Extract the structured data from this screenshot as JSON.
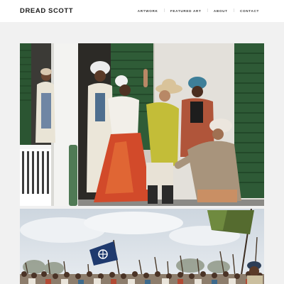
{
  "site": {
    "brand": "DREAD SCOTT"
  },
  "nav": {
    "items": [
      {
        "label": "ARTWORK"
      },
      {
        "label": "FEATURED ART"
      },
      {
        "label": "ABOUT"
      },
      {
        "label": "CONTACT"
      }
    ],
    "separator": "|"
  },
  "gallery": {
    "photos": [
      {
        "subject": "performers in historical costume on a plantation house porch"
      },
      {
        "subject": "crowd of marchers raising tools and flags under a cloudy sky"
      }
    ]
  },
  "colors": {
    "header_bg": "#ffffff",
    "page_bg": "#f1f1f1",
    "brand_text": "#1b1b1b",
    "shutter_green": "#2e5a36"
  }
}
